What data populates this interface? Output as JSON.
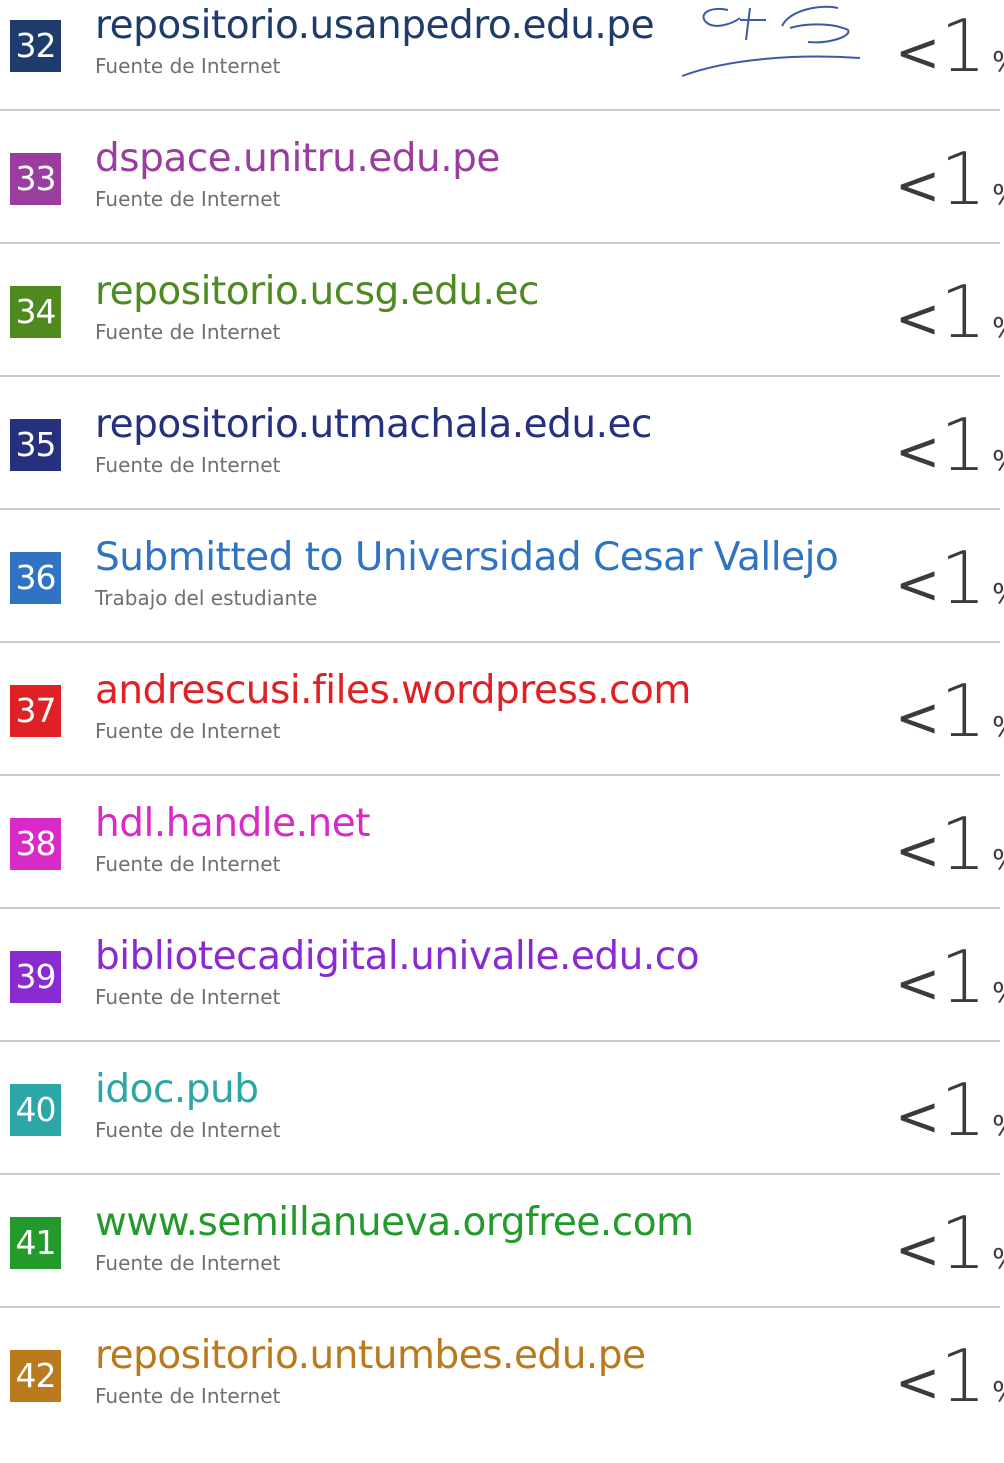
{
  "sources": [
    {
      "number": "32",
      "title": "repositorio.usanpedro.edu.pe",
      "type": "Fuente de Internet",
      "percent_lt": "<1",
      "percent_sym": "%",
      "color": "#1d3c6b"
    },
    {
      "number": "33",
      "title": "dspace.unitru.edu.pe",
      "type": "Fuente de Internet",
      "percent_lt": "<1",
      "percent_sym": "%",
      "color": "#9b3d9f"
    },
    {
      "number": "34",
      "title": "repositorio.ucsg.edu.ec",
      "type": "Fuente de Internet",
      "percent_lt": "<1",
      "percent_sym": "%",
      "color": "#4e8a1f"
    },
    {
      "number": "35",
      "title": "repositorio.utmachala.edu.ec",
      "type": "Fuente de Internet",
      "percent_lt": "<1",
      "percent_sym": "%",
      "color": "#25307e"
    },
    {
      "number": "36",
      "title": "Submitted to Universidad Cesar Vallejo",
      "type": "Trabajo del estudiante",
      "percent_lt": "<1",
      "percent_sym": "%",
      "color": "#2f73c2"
    },
    {
      "number": "37",
      "title": "andrescusi.files.wordpress.com",
      "type": "Fuente de Internet",
      "percent_lt": "<1",
      "percent_sym": "%",
      "color": "#df2024"
    },
    {
      "number": "38",
      "title": "hdl.handle.net",
      "type": "Fuente de Internet",
      "percent_lt": "<1",
      "percent_sym": "%",
      "color": "#d72ac7"
    },
    {
      "number": "39",
      "title": "bibliotecadigital.univalle.edu.co",
      "type": "Fuente de Internet",
      "percent_lt": "<1",
      "percent_sym": "%",
      "color": "#8a2bd1"
    },
    {
      "number": "40",
      "title": "idoc.pub",
      "type": "Fuente de Internet",
      "percent_lt": "<1",
      "percent_sym": "%",
      "color": "#2aa7a6"
    },
    {
      "number": "41",
      "title": "www.semillanueva.orgfree.com",
      "type": "Fuente de Internet",
      "percent_lt": "<1",
      "percent_sym": "%",
      "color": "#239a2c"
    },
    {
      "number": "42",
      "title": "repositorio.untumbes.edu.pe",
      "type": "Fuente de Internet",
      "percent_lt": "<1",
      "percent_sym": "%",
      "color": "#b97a1d"
    }
  ]
}
